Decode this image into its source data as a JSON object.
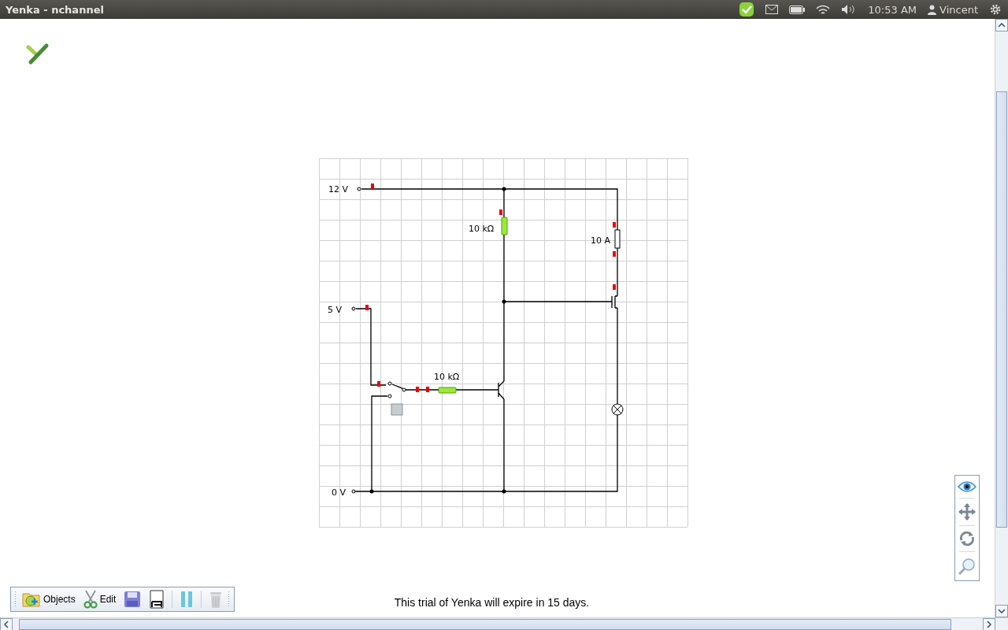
{
  "window": {
    "title": "Yenka - nchannel"
  },
  "status_bar": {
    "time": "10:53 AM",
    "user": "Vincent"
  },
  "circuit": {
    "supplies": [
      {
        "label": "12 V"
      },
      {
        "label": "5 V"
      },
      {
        "label": "0 V"
      }
    ],
    "resistors": [
      {
        "label": "10 kΩ"
      },
      {
        "label": "10 kΩ"
      }
    ],
    "fuse": {
      "label": "10 A"
    }
  },
  "toolbar": {
    "buttons": [
      {
        "kind": "objects",
        "label": "Objects",
        "disabled": false
      },
      {
        "kind": "edit",
        "label": "Edit",
        "disabled": false
      },
      {
        "kind": "save",
        "disabled": false
      },
      {
        "kind": "save_as",
        "disabled": false
      },
      {
        "kind": "pause",
        "disabled": false
      },
      {
        "kind": "delete",
        "disabled": true
      }
    ]
  },
  "notice": "This trial of Yenka will expire in 15 days."
}
